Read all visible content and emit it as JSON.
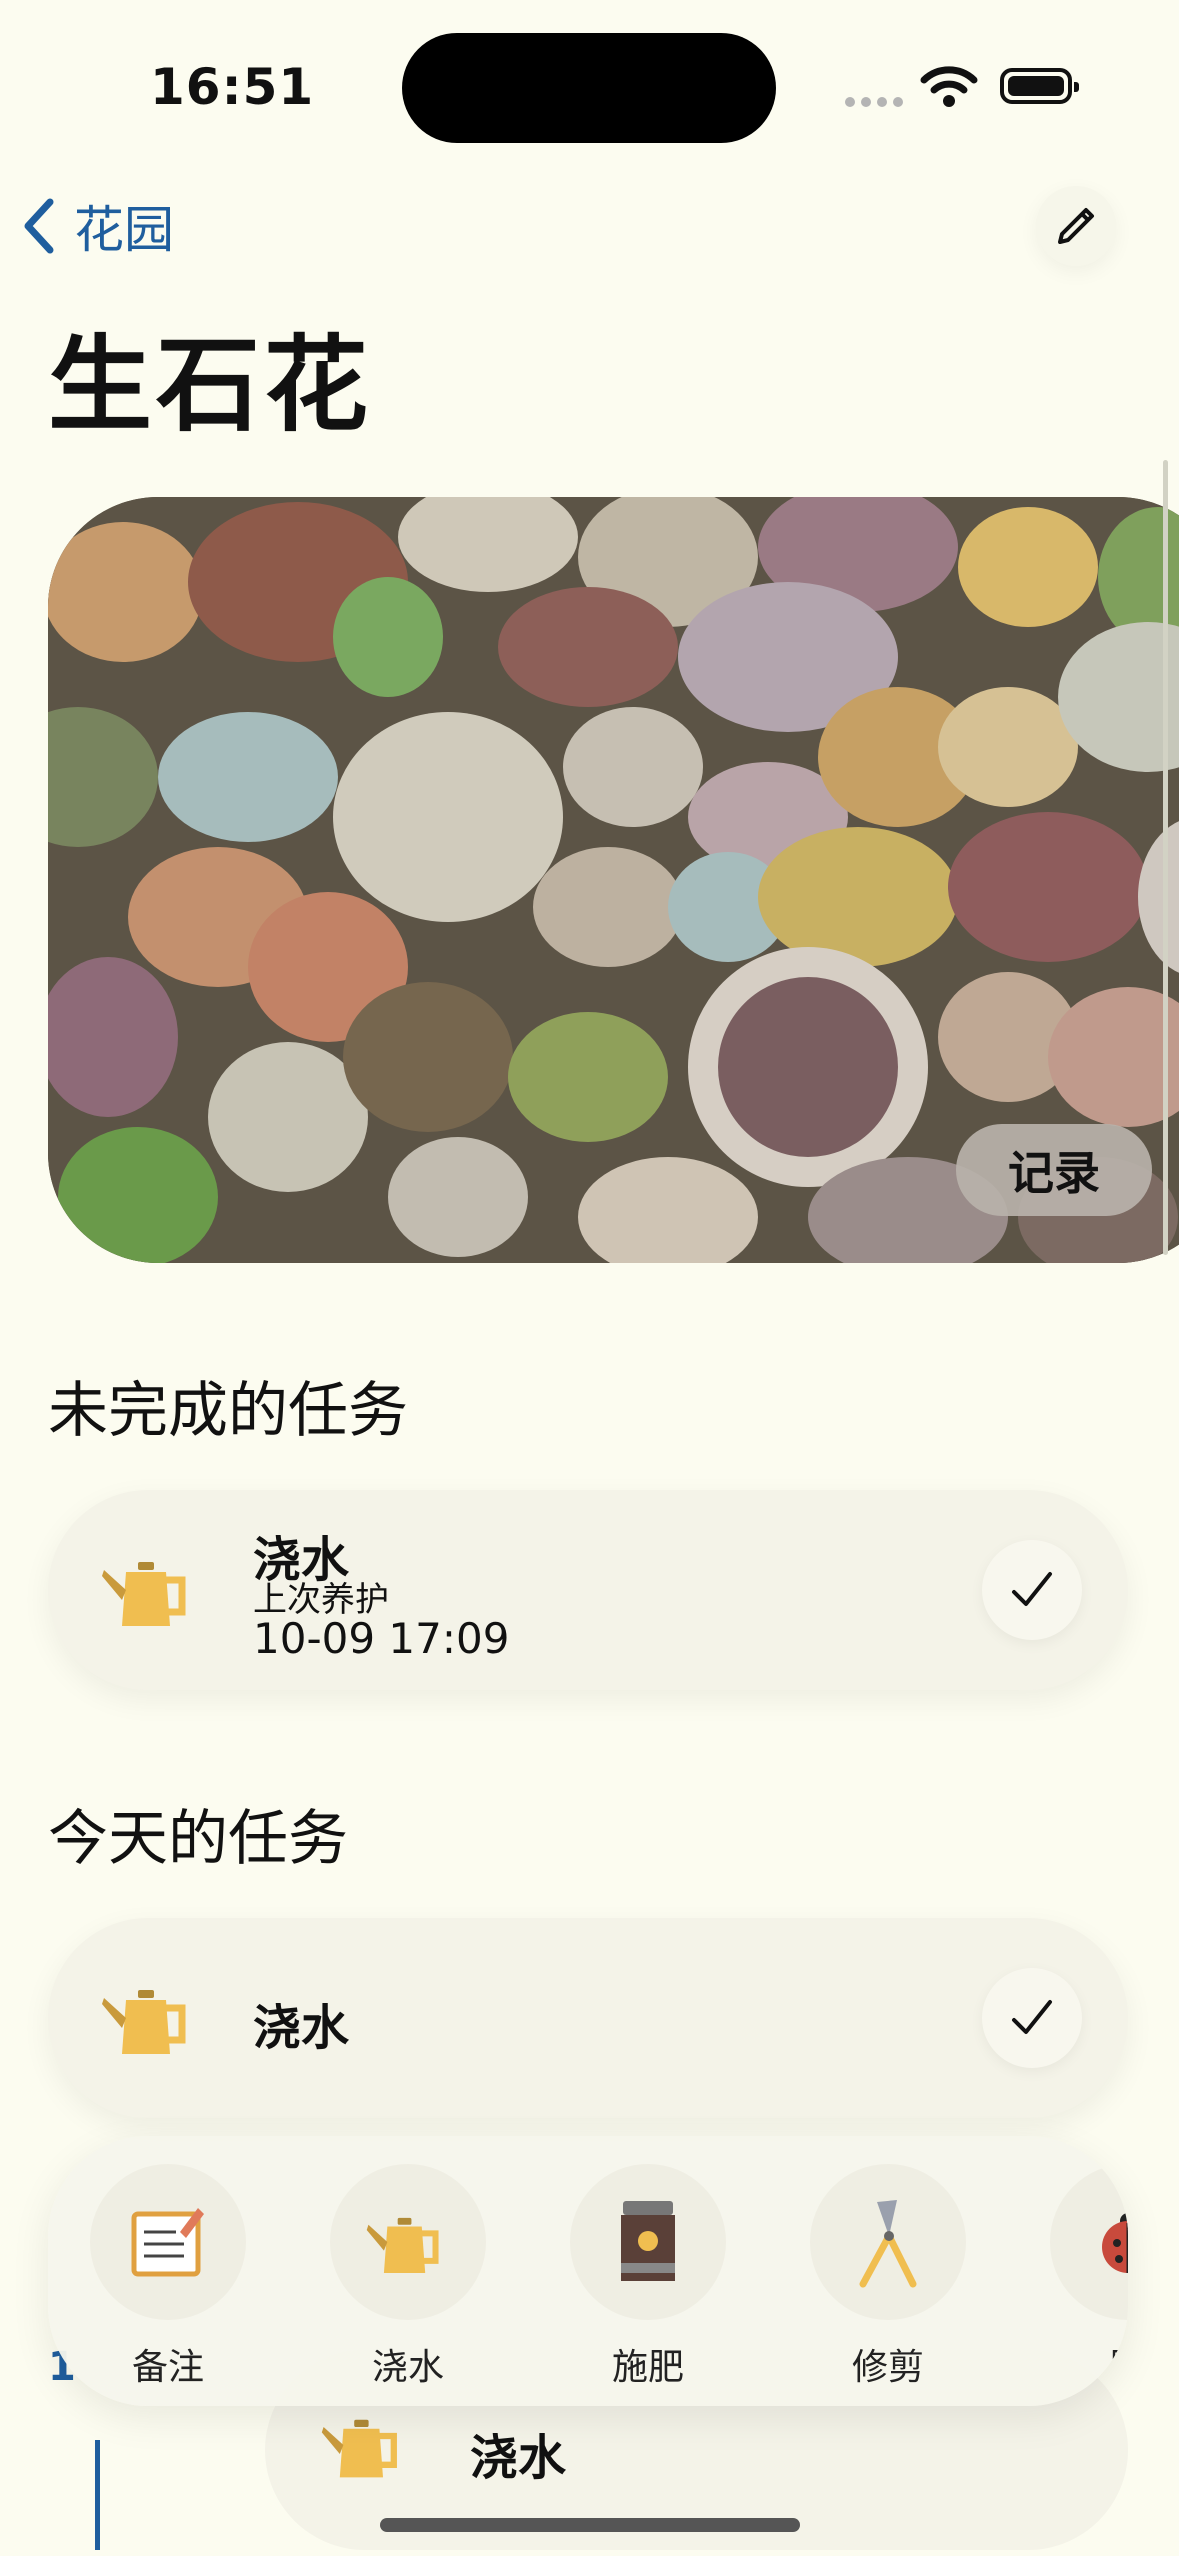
{
  "status_bar": {
    "time": "16:51"
  },
  "nav": {
    "back_label": "花园"
  },
  "plant": {
    "name": "生石花",
    "record_label": "记录"
  },
  "sections": {
    "incomplete": "未完成的任务",
    "today": "今天的任务"
  },
  "incomplete_tasks": [
    {
      "name": "浇水",
      "last_care_label": "上次养护",
      "last_care_time": "10-09 17:09"
    }
  ],
  "today_tasks": [
    {
      "name": "浇水"
    }
  ],
  "toolbar": {
    "items": [
      {
        "label": "备注",
        "icon": "note-icon"
      },
      {
        "label": "浇水",
        "icon": "watering-can-icon"
      },
      {
        "label": "施肥",
        "icon": "fertilizer-bag-icon"
      },
      {
        "label": "修剪",
        "icon": "pruning-shears-icon"
      },
      {
        "label": "除",
        "icon": "ladybug-icon"
      }
    ]
  },
  "timeline": {
    "entry_name": "浇水",
    "number_fragment": "1"
  },
  "colors": {
    "background": "#fcfcf0",
    "accent": "#1f5e9e",
    "watering_can": "#f0be50"
  }
}
